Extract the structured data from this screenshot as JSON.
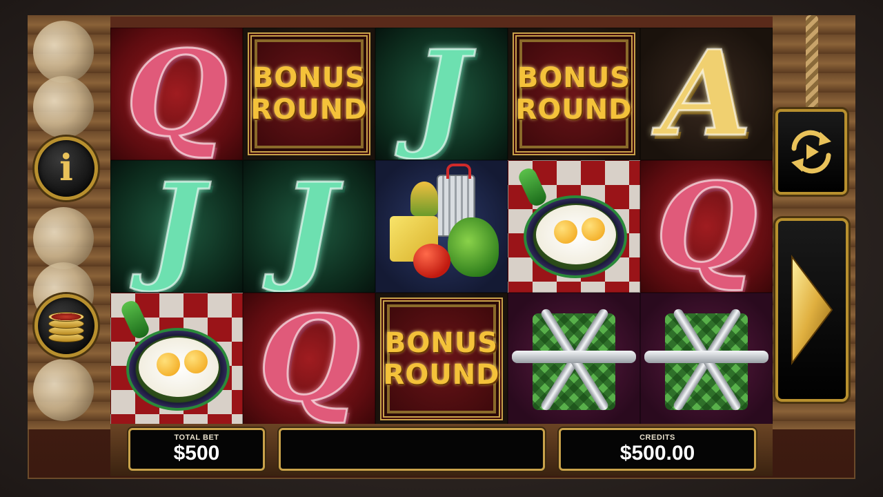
{
  "side_controls": {
    "info_glyph": "i"
  },
  "reels": [
    [
      "Q",
      "BONUS_ROUND",
      "J",
      "BONUS_ROUND",
      "A"
    ],
    [
      "J",
      "J",
      "VEGETABLES",
      "EGGS_PAN",
      "Q"
    ],
    [
      "EGGS_PAN",
      "Q",
      "BONUS_ROUND",
      "CUTLERY",
      "CUTLERY"
    ]
  ],
  "bonus_symbol": {
    "line1": "BONUS",
    "line2": "ROUND"
  },
  "footer": {
    "total_bet_label": "TOTAL BET",
    "total_bet_value": "$500",
    "message": "",
    "credits_label": "CREDITS",
    "credits_value": "$500.00"
  },
  "colors": {
    "gold_trim": "#c9a24a",
    "q_symbol": "#e05a7a",
    "j_symbol": "#6de0b0",
    "a_symbol": "#f0d070",
    "bonus_text": "#f4c23a"
  },
  "icons": {
    "info": "info-icon",
    "bet": "coin-stack-icon",
    "autoplay": "autoplay-repeat-icon",
    "spin": "play-triangle-icon"
  }
}
